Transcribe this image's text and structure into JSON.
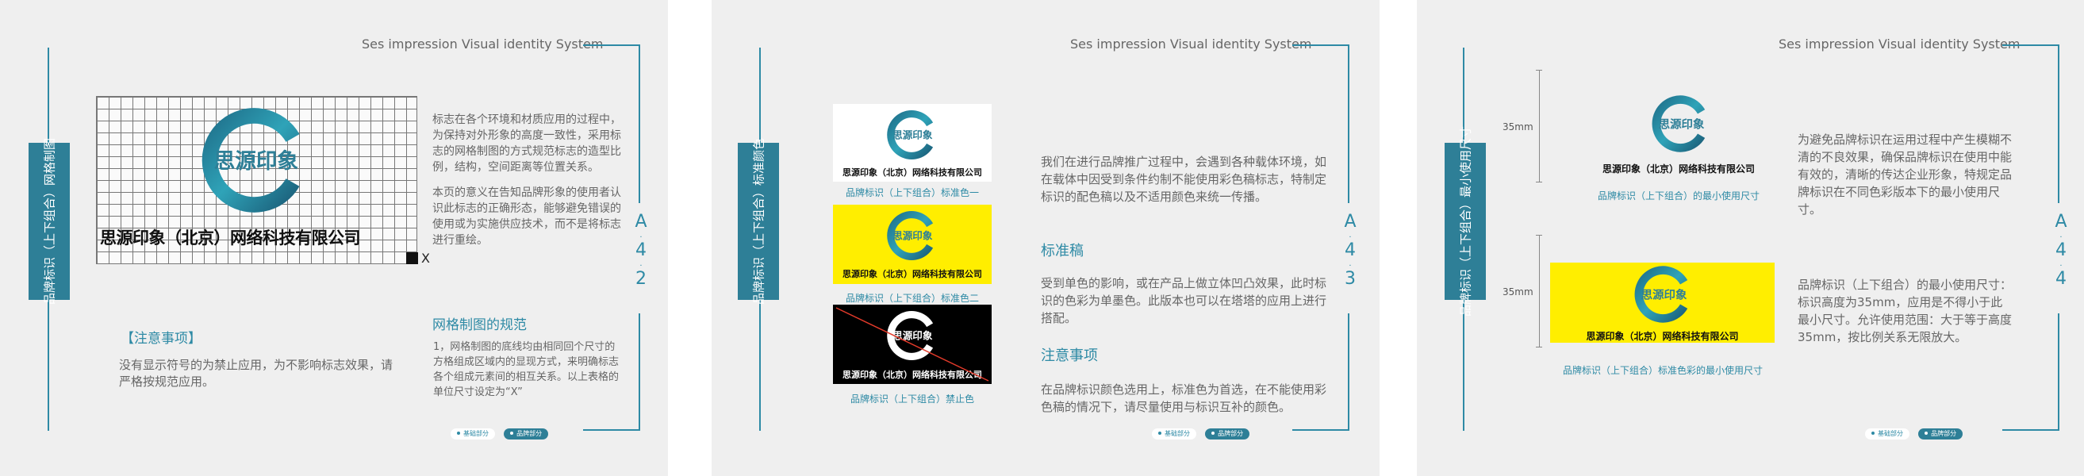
{
  "header_text": "Ses impression Visual identity System",
  "logo_text": "思源印象",
  "company_name": "思源印象（北京）网络科技有限公司",
  "buttons": {
    "left": "基础部分",
    "right": "品牌部分"
  },
  "colors": {
    "accent": "#2e8aa5",
    "tab": "#2e7f97",
    "yellow": "#ffee00",
    "black": "#000000",
    "panel": "#efefef"
  },
  "page1": {
    "tab": "品牌标识（上下组合）网格制图",
    "page_number": [
      "A",
      "4",
      "2"
    ],
    "grid_marker": "X",
    "body_paragraphs": [
      "标志在各个环境和材质应用的过程中，为保持对外形象的高度一致性，采用标志的网格制图的方式规范标志的造型比例，结构，空间距离等位置关系。",
      "本页的意义在告知品牌形象的使用者认识此标志的正确形态，能够避免错误的使用或为实施供应技术，而不是将标志进行重绘。"
    ],
    "notice_title": "【注意事项】",
    "notice_body": "没有显示符号的为禁止应用，为不影响标志效果，请严格按规范应用。",
    "grid_title": "网格制图的规范",
    "grid_body": "1，网格制图的底线均由相同回个尺寸的方格组成区域内的显现方式，来明确标志各个组成元素间的相互关系。以上表格的单位尺寸设定为“X”"
  },
  "page2": {
    "tab": "品牌标识（上下组合）标准颜色",
    "page_number": [
      "A",
      "4",
      "3"
    ],
    "captions": [
      "品牌标识（上下组合）标准色一",
      "品牌标识（上下组合）标准色二",
      "品牌标识（上下组合）禁止色"
    ],
    "intro": "我们在进行品牌推广过程中，会遇到各种载体环境，如在载体中因受到条件约制不能使用彩色稿标志，特制定标识的配色稿以及不适用颜色来统一传播。",
    "std_title": "标准稿",
    "std_body": "受到单色的影响，或在产品上做立体凹凸效果，此时标识的色彩为单墨色。此版本也可以在塔塔的应用上进行搭配。",
    "notice_title": "注意事项",
    "notice_body": "在品牌标识颜色选用上，标准色为首选，在不能使用彩色稿的情况下，请尽量使用与标识互补的颜色。"
  },
  "page3": {
    "tab": "品牌标识（上下组合）最小使用尺寸",
    "page_number": [
      "A",
      "4",
      "4"
    ],
    "dim1": "35mm",
    "dim2": "35mm",
    "caption1": "品牌标识（上下组合）的最小使用尺寸",
    "caption2": "品牌标识（上下组合）标准色彩的最小使用尺寸",
    "body1": "为避免品牌标识在运用过程中产生模糊不清的不良效果，确保品牌标识在使用中能有效的，清晰的传达企业形象，特规定品牌标识在不同色彩版本下的最小使用尺寸。",
    "body2": "品牌标识（上下组合）的最小使用尺寸：标识高度为35mm，应用是不得小于此最小尺寸。允许使用范围：大于等于高度35mm，按比例关系无限放大。"
  }
}
